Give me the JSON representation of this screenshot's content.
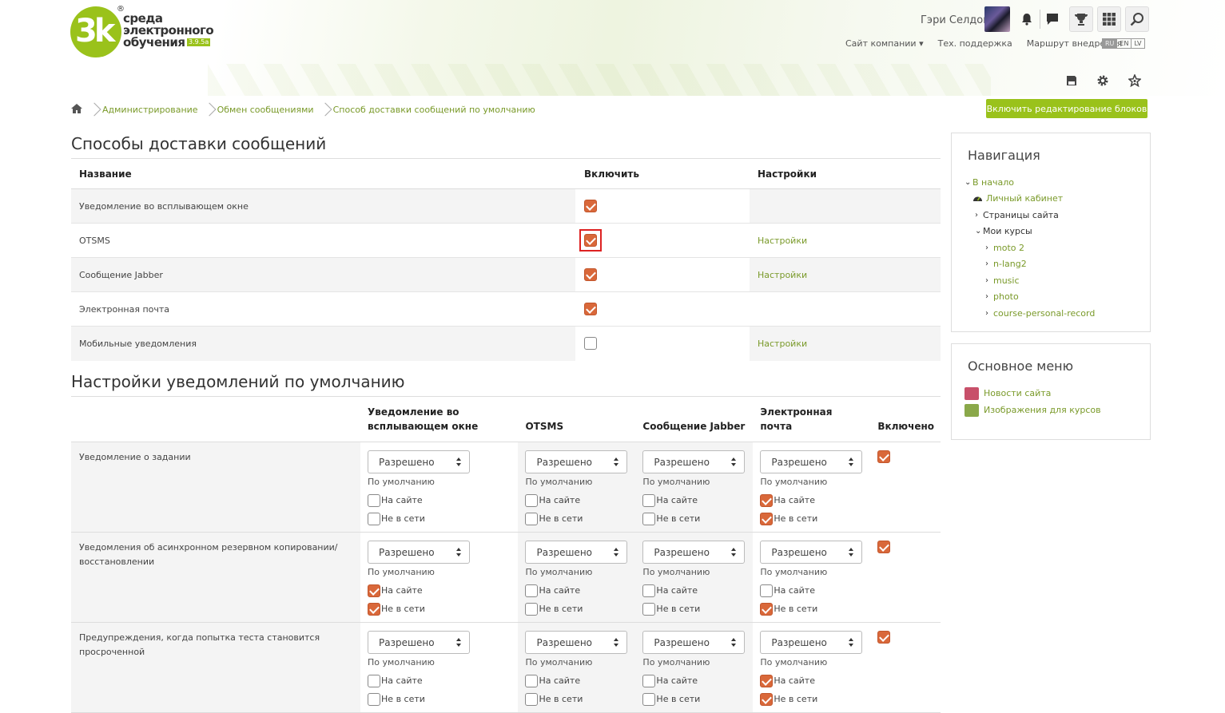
{
  "header": {
    "logo_mark": "3k",
    "logo_reg": "®",
    "logo_lines": [
      "среда",
      "электронного",
      "обучения"
    ],
    "logo_version": "3.9.5a",
    "user_name": "Гэри Селдон",
    "icons": [
      "bell-icon",
      "chat-icon",
      "trophy-icon",
      "grid-icon",
      "search-icon"
    ],
    "links": {
      "company": "Сайт компании ▾",
      "support": "Тех. поддержка",
      "route": "Маршрут внедрения"
    },
    "langs": [
      "RU",
      "EN",
      "LV"
    ],
    "active_lang": "RU",
    "page_icons": [
      "save-icon",
      "gear-icon",
      "star-icon"
    ]
  },
  "breadcrumb": {
    "home_icon": "home-icon",
    "items": [
      "Администрирование",
      "Обмен сообщениями",
      "Способ доставки сообщений по умолчанию"
    ]
  },
  "edit_button": "Включить редактирование блоков",
  "processors": {
    "title": "Способы доставки сообщений",
    "headers": [
      "Название",
      "Включить",
      "Настройки"
    ],
    "rows": [
      {
        "name": "Уведомление во всплывающем окне",
        "enabled": true,
        "settings": ""
      },
      {
        "name": "OTSMS",
        "enabled": true,
        "settings": "Настройки",
        "highlighted": true
      },
      {
        "name": "Сообщение Jabber",
        "enabled": true,
        "settings": "Настройки"
      },
      {
        "name": "Электронная почта",
        "enabled": true,
        "settings": ""
      },
      {
        "name": "Мобильные уведомления",
        "enabled": false,
        "settings": "Настройки"
      }
    ]
  },
  "defaults": {
    "title": "Настройки уведомлений по умолчанию",
    "headers": [
      "",
      "Уведомление во всплывающем окне",
      "OTSMS",
      "Сообщение Jabber",
      "Электронная почта",
      "Включено"
    ],
    "select_value": "Разрешено",
    "default_label": "По умолчанию",
    "online_label": "На сайте",
    "offline_label": "Не в сети",
    "rows": [
      {
        "name": "Уведомление о задании",
        "cells": [
          [
            false,
            false
          ],
          [
            false,
            false
          ],
          [
            false,
            false
          ],
          [
            true,
            true
          ]
        ],
        "enabled": true
      },
      {
        "name": "Уведомления об асинхронном резервном копировании/восстановлении",
        "cells": [
          [
            true,
            true
          ],
          [
            false,
            false
          ],
          [
            false,
            false
          ],
          [
            false,
            true
          ]
        ],
        "enabled": true
      },
      {
        "name": "Предупреждения, когда попытка теста становится просроченной",
        "cells": [
          [
            false,
            false
          ],
          [
            false,
            false
          ],
          [
            false,
            false
          ],
          [
            true,
            true
          ]
        ],
        "enabled": true
      }
    ]
  },
  "navigation": {
    "title": "Навигация",
    "home": "В начало",
    "dashboard": "Личный кабинет",
    "site_pages": "Страницы сайта",
    "my_courses": "Мои курсы",
    "courses": [
      "moto 2",
      "n-lang2",
      "music",
      "photo",
      "course-personal-record"
    ]
  },
  "main_menu": {
    "title": "Основное меню",
    "items": [
      {
        "label": "Новости сайта",
        "icon": "forum-icon",
        "color": "#c8506a"
      },
      {
        "label": "Изображения для курсов",
        "icon": "page-icon",
        "color": "#8aa84a"
      }
    ]
  },
  "colors": {
    "accent": "#9ac21b",
    "link": "#7a9a2a",
    "checkbox": "#d9683a",
    "highlight": "#dd2222"
  }
}
